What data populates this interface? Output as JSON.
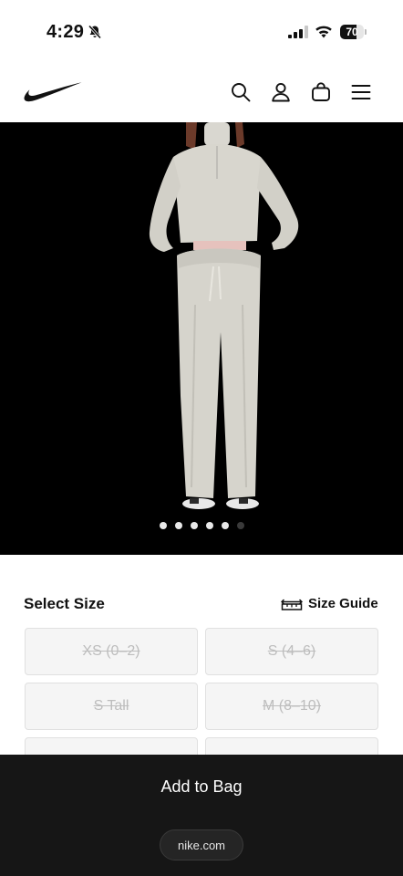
{
  "status_bar": {
    "time": "4:29",
    "battery_level": "70",
    "battery_fraction": 0.7,
    "icons": [
      "bell-off-icon",
      "signal-icon",
      "wifi-icon",
      "battery-icon"
    ]
  },
  "header": {
    "logo": "nike-swoosh-logo",
    "icons": [
      "search-icon",
      "account-icon",
      "bag-icon",
      "menu-icon"
    ]
  },
  "gallery": {
    "image": "product-photo-model",
    "dots_total": 6,
    "active_dots": 5
  },
  "size_section": {
    "title": "Select Size",
    "guide_label": "Size Guide",
    "guide_icon": "ruler-icon",
    "sizes": [
      {
        "label": "XS (0–2)",
        "available": false
      },
      {
        "label": "S (4–6)",
        "available": false
      },
      {
        "label": "S Tall",
        "available": false
      },
      {
        "label": "M (8–10)",
        "available": false
      },
      {
        "label": "",
        "available": false
      },
      {
        "label": "",
        "available": false
      }
    ]
  },
  "bottom_bar": {
    "cta_label": "Add to Bag",
    "url": "nike.com"
  },
  "colors": {
    "hero_background": "#000000",
    "bottom_bar": "#161616",
    "tile_background": "#f5f5f5",
    "tile_disabled_text": "#bdbdbd"
  }
}
